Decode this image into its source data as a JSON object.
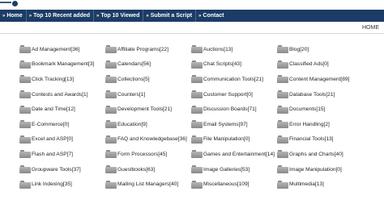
{
  "nav": {
    "items": [
      {
        "label": "Home"
      },
      {
        "label": "Top 10 Recent added"
      },
      {
        "label": "Top 10 Viewed"
      },
      {
        "label": "Submit a Script"
      },
      {
        "label": "Contact"
      }
    ]
  },
  "breadcrumb": {
    "home": "HOME"
  },
  "categories": [
    {
      "label": "Ad Management",
      "count": "[36]"
    },
    {
      "label": "Affiliate Programs",
      "count": "[22]"
    },
    {
      "label": "Auctions",
      "count": "[13]"
    },
    {
      "label": "Blog",
      "count": "[20]"
    },
    {
      "label": "Bookmark Management",
      "count": "[3]"
    },
    {
      "label": "Calendars",
      "count": "[56]"
    },
    {
      "label": "Chat Scripts",
      "count": "[43]"
    },
    {
      "label": "Classified Ads",
      "count": "[0]"
    },
    {
      "label": "Click Tracking",
      "count": "[13]"
    },
    {
      "label": "Collections",
      "count": "[5]"
    },
    {
      "label": "Communication Tools",
      "count": "[21]"
    },
    {
      "label": "Content Management",
      "count": "[89]"
    },
    {
      "label": "Contests and Awards",
      "count": "[1]"
    },
    {
      "label": "Counters",
      "count": "[1]"
    },
    {
      "label": "Customer Support",
      "count": "[0]"
    },
    {
      "label": "Database Tools",
      "count": "[21]"
    },
    {
      "label": "Date and Time",
      "count": "[12]"
    },
    {
      "label": "Development Tools",
      "count": "[21]"
    },
    {
      "label": "Discussion Boards",
      "count": "[71]"
    },
    {
      "label": "Documents",
      "count": "[15]"
    },
    {
      "label": "E-Commerce",
      "count": "[0]"
    },
    {
      "label": "Education",
      "count": "[9]"
    },
    {
      "label": "Email Systems",
      "count": "[97]"
    },
    {
      "label": "Error Handling",
      "count": "[2]"
    },
    {
      "label": "Excel and ASP",
      "count": "[0]"
    },
    {
      "label": "FAQ and Knowledgebase",
      "count": "[36]"
    },
    {
      "label": "File Manipulation",
      "count": "[0]"
    },
    {
      "label": "Financial Tools",
      "count": "[13]"
    },
    {
      "label": "Flash and ASP",
      "count": "[7]"
    },
    {
      "label": "Form Processors",
      "count": "[45]"
    },
    {
      "label": "Games and Entertainment",
      "count": "[14]"
    },
    {
      "label": "Graphs and Charts",
      "count": "[40]"
    },
    {
      "label": "Groupware Tools",
      "count": "[37]"
    },
    {
      "label": "Guestbooks",
      "count": "[63]"
    },
    {
      "label": "Image Galleries",
      "count": "[53]"
    },
    {
      "label": "Image Manipulation",
      "count": "[0]"
    },
    {
      "label": "Link Indexing",
      "count": "[35]"
    },
    {
      "label": "Mailing List Managers",
      "count": "[40]"
    },
    {
      "label": "Miscellaneous",
      "count": "[109]"
    },
    {
      "label": "Multimedia",
      "count": "[13]"
    }
  ]
}
